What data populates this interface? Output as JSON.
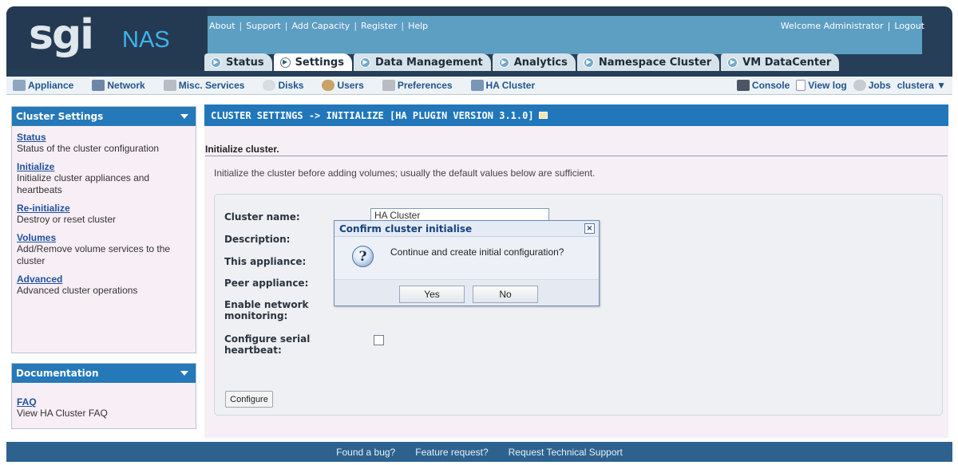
{
  "brand": {
    "logo": "sgi",
    "product": "NAS"
  },
  "header": {
    "links": [
      "About",
      "Support",
      "Add Capacity",
      "Register",
      "Help"
    ],
    "separator": "|",
    "welcome": "Welcome Administrator",
    "logout": "Logout"
  },
  "main_tabs": [
    {
      "label": "Status",
      "icon": "arrow-icon"
    },
    {
      "label": "Settings",
      "icon": "arrow-icon",
      "active": true
    },
    {
      "label": "Data Management",
      "icon": "arrow-icon"
    },
    {
      "label": "Analytics",
      "icon": "arrow-icon"
    },
    {
      "label": "Namespace Cluster",
      "icon": "arrow-icon"
    },
    {
      "label": "VM DataCenter",
      "icon": "arrow-icon"
    }
  ],
  "subnav": {
    "items": [
      {
        "label": "Appliance",
        "icon": "appliance-icon"
      },
      {
        "label": "Network",
        "icon": "network-icon"
      },
      {
        "label": "Misc. Services",
        "icon": "tools-icon"
      },
      {
        "label": "Disks",
        "icon": "disk-icon"
      },
      {
        "label": "Users",
        "icon": "users-icon"
      },
      {
        "label": "Preferences",
        "icon": "preferences-icon"
      },
      {
        "label": "HA Cluster",
        "icon": "cluster-icon"
      }
    ],
    "right": [
      {
        "label": "Console",
        "icon": "console-icon"
      },
      {
        "label": "View log",
        "icon": "log-icon"
      },
      {
        "label": "Jobs",
        "icon": "jobs-icon"
      }
    ],
    "host": "clustera ▼"
  },
  "sidebar": {
    "cluster_settings": {
      "title": "Cluster Settings",
      "items": [
        {
          "link": "Status",
          "desc": "Status of the cluster configuration"
        },
        {
          "link": "Initialize",
          "desc": "Initialize cluster appliances and heartbeats"
        },
        {
          "link": "Re-initialize",
          "desc": "Destroy or reset cluster"
        },
        {
          "link": "Volumes",
          "desc": "Add/Remove volume services to the cluster"
        },
        {
          "link": "Advanced",
          "desc": "Advanced cluster operations"
        }
      ]
    },
    "documentation": {
      "title": "Documentation",
      "items": [
        {
          "link": "FAQ",
          "desc": "View HA Cluster FAQ"
        }
      ]
    }
  },
  "main": {
    "title": "CLUSTER SETTINGS -> INITIALIZE [HA PLUGIN VERSION 3.1.0]",
    "heading": "Initialize cluster.",
    "intro": "Initialize the cluster before adding volumes; usually the default values below are sufficient.",
    "form": {
      "cluster_name_label": "Cluster name:",
      "cluster_name_value": "HA Cluster",
      "description_label": "Description:",
      "this_appliance_label": "This appliance:",
      "peer_appliance_label": "Peer appliance:",
      "enable_network_label": "Enable network monitoring:",
      "configure_serial_label": "Configure serial heartbeat:",
      "configure_button": "Configure"
    }
  },
  "dialog": {
    "title": "Confirm cluster initialise",
    "message": "Continue and create initial configuration?",
    "yes": "Yes",
    "no": "No",
    "close": "×"
  },
  "footer": {
    "links": [
      "Found a bug?",
      "Feature request?",
      "Request Technical Support"
    ]
  },
  "colors": {
    "header_bg": "#263e57",
    "topband": "#5d9ec3",
    "accent_blue": "#2177b9",
    "sidebar_bg": "#f8eff6",
    "footer_bg": "#2d628f",
    "nas_blue": "#3fb2ee"
  }
}
